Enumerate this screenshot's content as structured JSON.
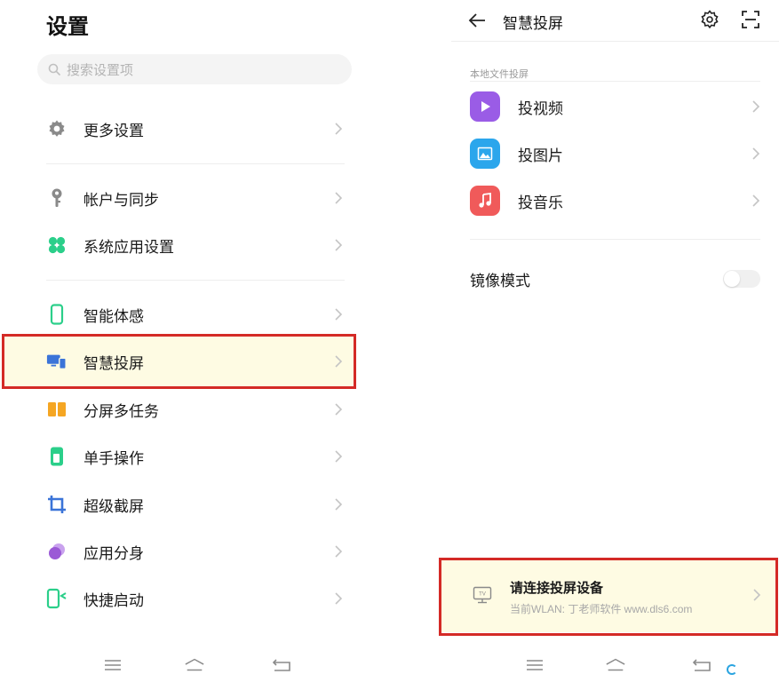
{
  "left": {
    "title": "设置",
    "search": {
      "placeholder": "搜索设置项"
    },
    "items": [
      {
        "label": "更多设置",
        "icon": "gear-icon",
        "color": "#8a8a8a"
      },
      {
        "label": "帐户与同步",
        "icon": "key-icon",
        "color": "#8a8a8a"
      },
      {
        "label": "系统应用设置",
        "icon": "clover-icon",
        "color": "#2bcf8a"
      },
      {
        "label": "智能体感",
        "icon": "phone-outline-icon",
        "color": "#2bcf8a"
      },
      {
        "label": "智慧投屏",
        "icon": "screen-cast-icon",
        "color": "#3b74d8",
        "highlighted": true
      },
      {
        "label": "分屏多任务",
        "icon": "split-screen-icon",
        "color": "#f5a623"
      },
      {
        "label": "单手操作",
        "icon": "one-hand-icon",
        "color": "#2bcf8a"
      },
      {
        "label": "超级截屏",
        "icon": "crop-icon",
        "color": "#3b74d8"
      },
      {
        "label": "应用分身",
        "icon": "clone-icon",
        "color": "#9b59d6"
      },
      {
        "label": "快捷启动",
        "icon": "quick-launch-icon",
        "color": "#2bcf8a"
      }
    ]
  },
  "right": {
    "title": "智慧投屏",
    "section_label": "本地文件投屏",
    "media": [
      {
        "label": "投视频",
        "icon": "video-play-icon",
        "color": "#9a5ce6"
      },
      {
        "label": "投图片",
        "icon": "image-icon",
        "color": "#2ba6ec"
      },
      {
        "label": "投音乐",
        "icon": "music-note-icon",
        "color": "#f05a5a"
      }
    ],
    "mirror_label": "镜像模式",
    "mirror_on": false,
    "connect": {
      "title": "请连接投屏设备",
      "subtitle": "当前WLAN: 丁老师软件 www.dls6.com"
    }
  },
  "assistant_text": "",
  "colors": {
    "highlight_bg": "#fefbe3",
    "highlight_border": "#d42a26"
  }
}
